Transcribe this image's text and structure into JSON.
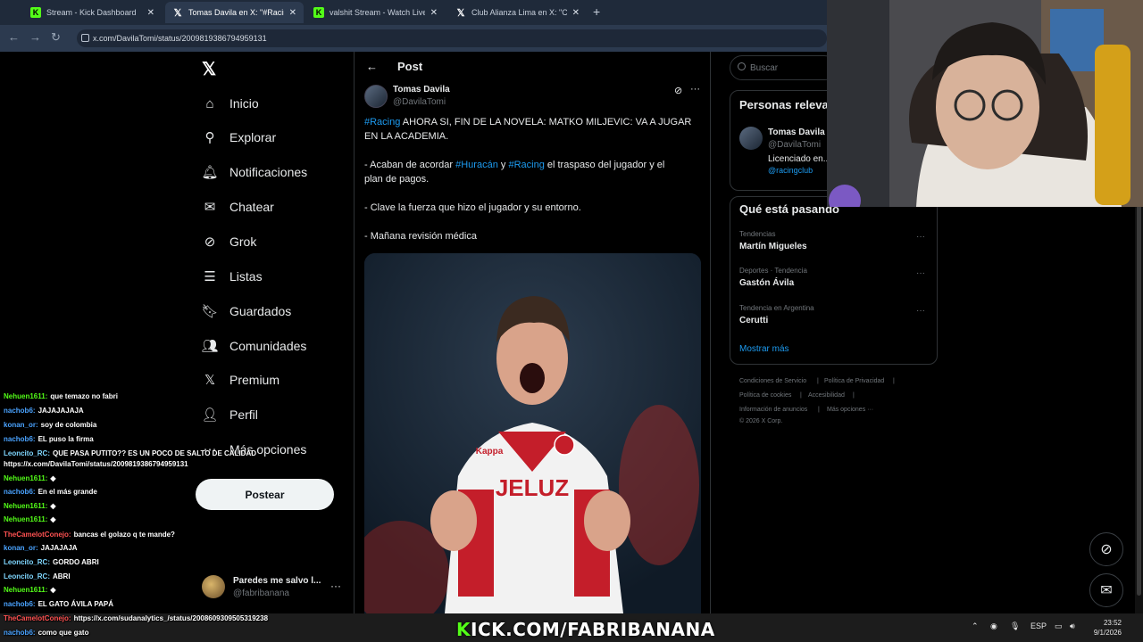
{
  "browser": {
    "tabs": [
      {
        "icon": "kick-icon",
        "label": "Stream - Kick Dashboard",
        "active": false
      },
      {
        "icon": "x-icon",
        "label": "Tomas Davila en X: \"#Racing AHORA SI\"",
        "active": true
      },
      {
        "icon": "kick-icon",
        "label": "valshit Stream - Watch Live on Kick",
        "active": false
      },
      {
        "icon": "x-icon",
        "label": "Club Alianza Lima en X: \"Cuando...\"",
        "active": false
      }
    ],
    "new_tab": "+",
    "url": "x.com/DavilaTomi/status/2009819386794959131"
  },
  "sidebar": {
    "items": [
      {
        "icon": "home-icon",
        "label": "Inicio"
      },
      {
        "icon": "search-icon",
        "label": "Explorar"
      },
      {
        "icon": "bell-icon",
        "label": "Notificaciones"
      },
      {
        "icon": "mail-icon",
        "label": "Chatear"
      },
      {
        "icon": "grok-icon",
        "label": "Grok"
      },
      {
        "icon": "list-icon",
        "label": "Listas"
      },
      {
        "icon": "bookmark-icon",
        "label": "Guardados"
      },
      {
        "icon": "communities-icon",
        "label": "Comunidades"
      },
      {
        "icon": "x-icon",
        "label": "Premium"
      },
      {
        "icon": "person-icon",
        "label": "Perfil"
      },
      {
        "icon": "more-icon",
        "label": "Más opciones"
      }
    ],
    "post_button": "Postear",
    "account": {
      "name": "Paredes me salvo l...",
      "handle": "@fabribanana",
      "more": "···"
    }
  },
  "post": {
    "header": "Post",
    "author": {
      "name": "Tomas Davila",
      "handle": "@DavilaTomi"
    },
    "more": "···",
    "text": {
      "l1_hash": "#Racing",
      "l1_rest": " AHORA SI, FIN DE LA NOVELA: MATKO MILJEVIC: VA A JUGAR",
      "l2": "EN LA ACADEMIA.",
      "l3_pre": "- Acaban de acordar ",
      "l3_hash1": "#Huracán",
      "l3_mid": " y ",
      "l3_hash2": "#Racing",
      "l3_rest": " el traspaso del jugador y el",
      "l4": "plan de pagos.",
      "l5": "- Clave la fuerza que hizo el jugador y su entorno.",
      "l6": "- Mañana revisión médica"
    },
    "media": {
      "jersey_text": "JELUZ",
      "sponsor": "Kappa"
    }
  },
  "right": {
    "search_placeholder": "Buscar",
    "relevant": {
      "title": "Personas relevantes",
      "name": "Tomas Davila",
      "handle": "@DavilaTomi",
      "bio": "Licenciado en...",
      "link": "@racingclub"
    },
    "trends": {
      "title": "Qué está pasando",
      "items": [
        {
          "context": "Tendencias",
          "name": "Martín Migueles"
        },
        {
          "context": "Deportes · Tendencia",
          "name": "Gastón Ávila"
        },
        {
          "context": "Tendencia en Argentina",
          "name": "Cerutti"
        }
      ],
      "more_dots": "···",
      "show_more": "Mostrar más"
    },
    "footer": {
      "terms": "Condiciones de Servicio",
      "privacy": "Política de Privacidad",
      "cookies": "Política de cookies",
      "accessibility": "Accesibilidad",
      "ads": "Información de anuncios",
      "more": "Más opciones ···",
      "copyright": "© 2026 X Corp.",
      "sep": "|"
    }
  },
  "chat": [
    {
      "user": "Nehuen1611:",
      "msg": "que temazo no fabri",
      "color": "u-green"
    },
    {
      "user": "nachob6:",
      "msg": "JAJAJAJAJA",
      "color": "u-blue"
    },
    {
      "user": "konan_or:",
      "msg": "soy de colombia",
      "color": "u-blue"
    },
    {
      "user": "nachob6:",
      "msg": "EL puso la firma",
      "color": "u-blue"
    },
    {
      "user": "Leoncito_RC:",
      "msg": "QUE PASA PUTITO?? ES UN POCO DE SALTO DE CALIDAD",
      "color": "u-cyan"
    },
    {
      "user": "",
      "msg": "https://x.com/DavilaTomi/status/2009819386794959131",
      "color": ""
    },
    {
      "user": "Nehuen1611:",
      "msg": "",
      "color": "u-green"
    },
    {
      "user": "nachob6:",
      "msg": "En el más grande",
      "color": "u-blue"
    },
    {
      "user": "Nehuen1611:",
      "msg": "",
      "color": "u-green"
    },
    {
      "user": "Nehuen1611:",
      "msg": "",
      "color": "u-green"
    },
    {
      "user": "Nehuen1611:",
      "msg": "",
      "color": "u-green"
    },
    {
      "user": "TheCamelotConejo:",
      "msg": "bancas el golazo q te mande?",
      "color": "u-red"
    },
    {
      "user": "konan_or:",
      "msg": "JAJAJAJA",
      "color": "u-blue"
    },
    {
      "user": "Leoncito_RC:",
      "msg": "GORDO ABRI",
      "color": "u-cyan"
    },
    {
      "user": "Leoncito_RC:",
      "msg": "ABRI",
      "color": "u-cyan"
    },
    {
      "user": "Nehuen1611:",
      "msg": "",
      "color": "u-green"
    },
    {
      "user": "nachob6:",
      "msg": "EL GATO ÁVILA PAPÁ",
      "color": "u-blue"
    },
    {
      "user": "TheCamelotConejo:",
      "msg": "https://x.com/sudanalytics_/status/2008609309505319238",
      "color": "u-red"
    },
    {
      "user": "nachob6:",
      "msg": "como que gato",
      "color": "u-blue"
    }
  ],
  "stream_banner": {
    "prefix": "K",
    "text": "ICK.COM/FABRIBANANA"
  },
  "taskbar": {
    "lang": "ESP",
    "time": "23:52",
    "date": "9/1/2026"
  },
  "colors": {
    "accent": "#1d9bf0",
    "kick_green": "#53fc18",
    "background": "#000000"
  }
}
